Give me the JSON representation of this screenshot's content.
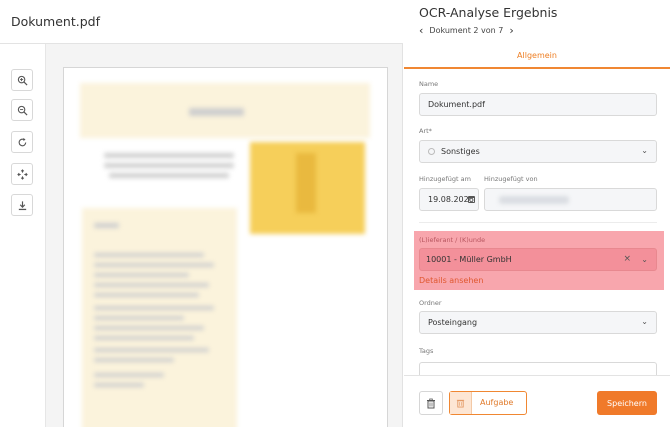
{
  "viewer": {
    "title": "Dokument.pdf",
    "tools": [
      {
        "name": "zoom-in-icon"
      },
      {
        "name": "zoom-out-icon"
      },
      {
        "name": "rotate-icon"
      },
      {
        "name": "fit-icon"
      },
      {
        "name": "download-icon"
      }
    ]
  },
  "panel": {
    "title": "OCR-Analyse Ergebnis",
    "nav_text": "Dokument 2 von 7",
    "nav_prev": "‹",
    "nav_next": "›",
    "tab": "Allgemein"
  },
  "form": {
    "name_label": "Name",
    "name_value": "Dokument.pdf",
    "art_label": "Art*",
    "art_value": "Sonstiges",
    "added_at_label": "Hinzugefügt am",
    "added_at_value": "19.08.2026",
    "added_by_label": "Hinzugefügt von",
    "supplier_label": "(L)ieferant / (K)unde",
    "supplier_value": "10001 - Müller GmbH",
    "details_link": "Details ansehen",
    "ordner_label": "Ordner",
    "ordner_value": "Posteingang",
    "tags_label": "Tags"
  },
  "footer": {
    "task_label": "Aufgabe",
    "save_label": "Speichern"
  },
  "colors": {
    "accent": "#f07a2a",
    "highlight": "#f8a6ad"
  }
}
